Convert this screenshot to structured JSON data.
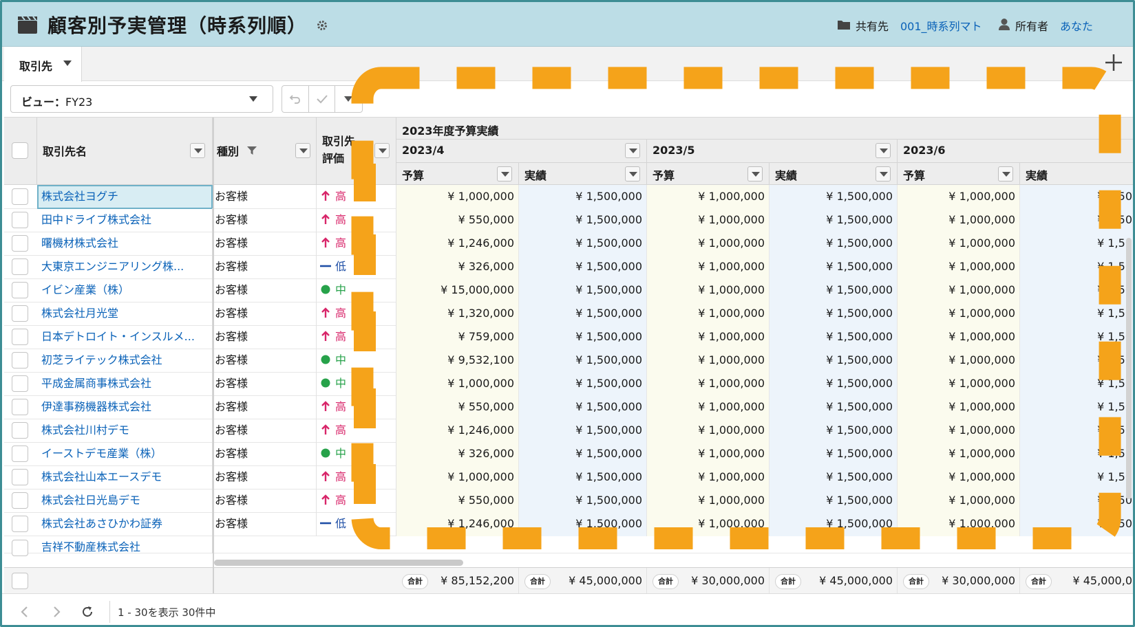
{
  "header": {
    "title": "顧客別予実管理（時系列順）",
    "share_label": "共有先",
    "share_value": "001_時系列マト",
    "owner_label": "所有者",
    "owner_value": "あなた",
    "bg_color": "#bcdde6"
  },
  "tabs": [
    {
      "label": "取引先"
    }
  ],
  "view": {
    "label": "ビュー：",
    "value": "FY23"
  },
  "columns": {
    "name": "取引先名",
    "kind": "種別",
    "rating_line1": "取引先",
    "rating_line2": "評価",
    "group": "2023年度予算実績",
    "months": [
      "2023/4",
      "2023/5",
      "2023/6"
    ],
    "budget": "予算",
    "actual": "実績"
  },
  "rows": [
    {
      "name": "株式会社ヨグチ",
      "kind": "お客様",
      "rating": "高",
      "level": "high",
      "v": [
        "¥ 1,000,000",
        "¥ 1,500,000",
        "¥ 1,000,000",
        "¥ 1,500,000",
        "¥ 1,000,000",
        "¥ 1,50"
      ]
    },
    {
      "name": "田中ドライブ株式会社",
      "kind": "お客様",
      "rating": "高",
      "level": "high",
      "v": [
        "¥ 550,000",
        "¥ 1,500,000",
        "¥ 1,000,000",
        "¥ 1,500,000",
        "¥ 1,000,000",
        "¥ 1,50"
      ]
    },
    {
      "name": "曙機材株式会社",
      "kind": "お客様",
      "rating": "高",
      "level": "high",
      "v": [
        "¥ 1,246,000",
        "¥ 1,500,000",
        "¥ 1,000,000",
        "¥ 1,500,000",
        "¥ 1,000,000",
        "¥ 1,50"
      ]
    },
    {
      "name": "大東京エンジニアリング株...",
      "kind": "お客様",
      "rating": "低",
      "level": "low",
      "v": [
        "¥ 326,000",
        "¥ 1,500,000",
        "¥ 1,000,000",
        "¥ 1,500,000",
        "¥ 1,000,000",
        "¥ 1,50"
      ]
    },
    {
      "name": "イビン産業（株）",
      "kind": "お客様",
      "rating": "中",
      "level": "mid",
      "v": [
        "¥ 15,000,000",
        "¥ 1,500,000",
        "¥ 1,000,000",
        "¥ 1,500,000",
        "¥ 1,000,000",
        "¥ 1,50"
      ]
    },
    {
      "name": "株式会社月光堂",
      "kind": "お客様",
      "rating": "高",
      "level": "high",
      "v": [
        "¥ 1,320,000",
        "¥ 1,500,000",
        "¥ 1,000,000",
        "¥ 1,500,000",
        "¥ 1,000,000",
        "¥ 1,50"
      ]
    },
    {
      "name": "日本デトロイト・インスルメ...",
      "kind": "お客様",
      "rating": "高",
      "level": "high",
      "v": [
        "¥ 759,000",
        "¥ 1,500,000",
        "¥ 1,000,000",
        "¥ 1,500,000",
        "¥ 1,000,000",
        "¥ 1,50"
      ]
    },
    {
      "name": "初芝ライテック株式会社",
      "kind": "お客様",
      "rating": "中",
      "level": "mid",
      "v": [
        "¥ 9,532,100",
        "¥ 1,500,000",
        "¥ 1,000,000",
        "¥ 1,500,000",
        "¥ 1,000,000",
        "¥ 1,50"
      ]
    },
    {
      "name": "平成金属商事株式会社",
      "kind": "お客様",
      "rating": "中",
      "level": "mid",
      "v": [
        "¥ 1,000,000",
        "¥ 1,500,000",
        "¥ 1,000,000",
        "¥ 1,500,000",
        "¥ 1,000,000",
        "¥ 1,50"
      ]
    },
    {
      "name": "伊達事務機器株式会社",
      "kind": "お客様",
      "rating": "高",
      "level": "high",
      "v": [
        "¥ 550,000",
        "¥ 1,500,000",
        "¥ 1,000,000",
        "¥ 1,500,000",
        "¥ 1,000,000",
        "¥ 1,50"
      ]
    },
    {
      "name": "株式会社川村デモ",
      "kind": "お客様",
      "rating": "高",
      "level": "high",
      "v": [
        "¥ 1,246,000",
        "¥ 1,500,000",
        "¥ 1,000,000",
        "¥ 1,500,000",
        "¥ 1,000,000",
        "¥ 1,50"
      ]
    },
    {
      "name": "イーストデモ産業（株）",
      "kind": "お客様",
      "rating": "中",
      "level": "mid",
      "v": [
        "¥ 326,000",
        "¥ 1,500,000",
        "¥ 1,000,000",
        "¥ 1,500,000",
        "¥ 1,000,000",
        "¥ 1,50"
      ]
    },
    {
      "name": "株式会社山本エースデモ",
      "kind": "お客様",
      "rating": "高",
      "level": "high",
      "v": [
        "¥ 1,000,000",
        "¥ 1,500,000",
        "¥ 1,000,000",
        "¥ 1,500,000",
        "¥ 1,000,000",
        "¥ 1,50"
      ]
    },
    {
      "name": "株式会社日光島デモ",
      "kind": "お客様",
      "rating": "高",
      "level": "high",
      "v": [
        "¥ 550,000",
        "¥ 1,500,000",
        "¥ 1,000,000",
        "¥ 1,500,000",
        "¥ 1,000,000",
        "¥ 1,50"
      ]
    },
    {
      "name": "株式会社あさひかわ証券",
      "kind": "お客様",
      "rating": "低",
      "level": "low",
      "v": [
        "¥ 1,246,000",
        "¥ 1,500,000",
        "¥ 1,000,000",
        "¥ 1,500,000",
        "¥ 1,000,000",
        "¥ 1,50"
      ]
    }
  ],
  "partial_row": {
    "name": "吉祥不動産株式会社"
  },
  "totals": {
    "badge": "合計",
    "values": [
      "¥ 85,152,200",
      "¥ 45,000,000",
      "¥ 30,000,000",
      "¥ 45,000,000",
      "¥ 30,000,000",
      "¥ 45,000,0"
    ]
  },
  "footer": {
    "count_text": "1 - 30を表示 30件中"
  },
  "colors": {
    "link": "#0a62b8",
    "high": "#d8266a",
    "mid": "#27a24a",
    "low": "#1f4fa6",
    "overlay": "#f5a31a"
  },
  "icons": {
    "rating_high": "arrow-up-icon",
    "rating_mid": "dot-icon",
    "rating_low": "dash-icon"
  }
}
